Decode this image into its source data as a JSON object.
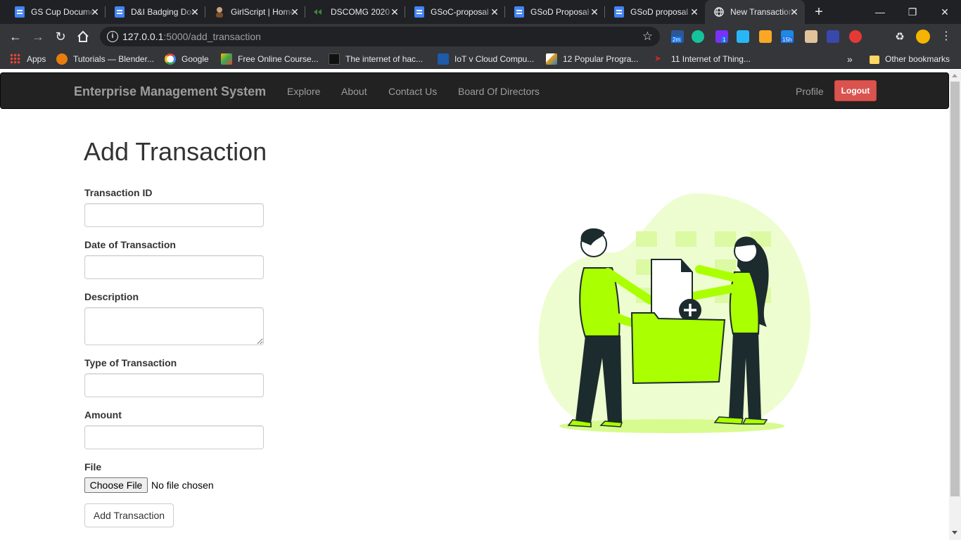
{
  "browser": {
    "tabs": [
      {
        "title": "GS Cup Document",
        "icon": "google-docs-icon"
      },
      {
        "title": "D&I Badging Doc",
        "icon": "google-docs-icon"
      },
      {
        "title": "GirlScript | Home",
        "icon": "girlscript-icon"
      },
      {
        "title": "DSCOMG 2020",
        "icon": "dscomg-icon"
      },
      {
        "title": "GSoC-proposal",
        "icon": "google-docs-icon"
      },
      {
        "title": "GSoD Proposal",
        "icon": "google-docs-icon"
      },
      {
        "title": "GSoD proposal",
        "icon": "google-docs-icon"
      },
      {
        "title": "New Transaction",
        "icon": "globe-icon",
        "active": true
      }
    ],
    "url_host": "127.0.0.1",
    "url_rest": ":5000/add_transaction",
    "extension_badges": [
      "2m",
      "1",
      "15h"
    ],
    "bookmarks": [
      {
        "label": "Apps",
        "icon": "apps-grid-icon"
      },
      {
        "label": "Tutorials — Blender...",
        "icon": "blender-icon"
      },
      {
        "label": "Google",
        "icon": "google-icon"
      },
      {
        "label": "Free Online Course...",
        "icon": "course-icon"
      },
      {
        "label": "The internet of hac...",
        "icon": "abc-icon"
      },
      {
        "label": "IoT v Cloud Compu...",
        "icon": "bi-icon"
      },
      {
        "label": "12 Popular Progra...",
        "icon": "mountain-icon"
      },
      {
        "label": "11 Internet of Thing...",
        "icon": "arrow-icon"
      }
    ],
    "overflow_label": "»",
    "other_bookmarks": "Other bookmarks"
  },
  "navbar": {
    "brand": "Enterprise Management System",
    "links": [
      "Explore",
      "About",
      "Contact Us",
      "Board Of Directors"
    ],
    "profile": "Profile",
    "logout": "Logout"
  },
  "form": {
    "heading": "Add Transaction",
    "fields": [
      {
        "label": "Transaction ID",
        "value": ""
      },
      {
        "label": "Date of Transaction",
        "value": ""
      },
      {
        "label": "Description",
        "value": ""
      },
      {
        "label": "Type of Transaction",
        "value": ""
      },
      {
        "label": "Amount",
        "value": ""
      }
    ],
    "file_label": "File",
    "file_button": "Choose File",
    "file_status": "No file chosen",
    "submit": "Add Transaction"
  },
  "colors": {
    "accent_green": "#aaff00",
    "logout_red": "#d9534f",
    "navbar_bg": "#222222"
  }
}
